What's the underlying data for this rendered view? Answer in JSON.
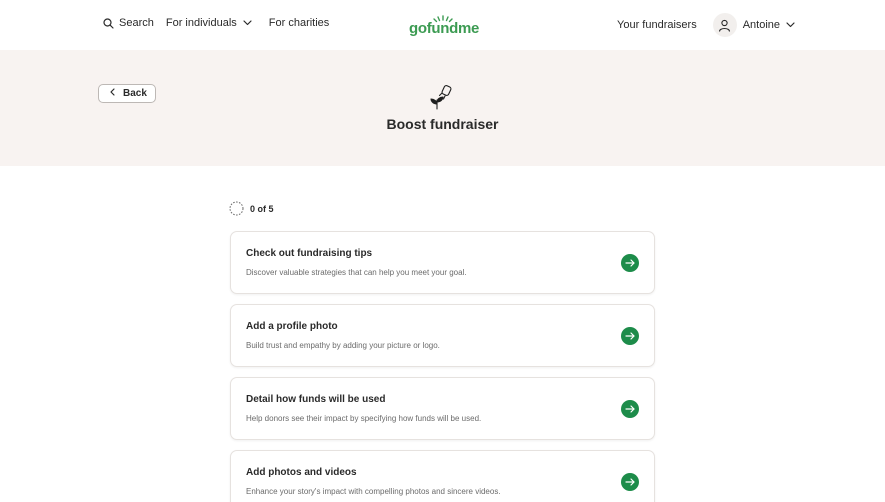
{
  "header": {
    "search_label": "Search",
    "individuals_label": "For individuals",
    "charities_label": "For charities",
    "logo_text": "gofundme",
    "fundraisers_label": "Your fundraisers",
    "user_name": "Antoine"
  },
  "hero": {
    "back_label": "Back",
    "title": "Boost fundraiser"
  },
  "progress": {
    "label": "0 of 5",
    "completed": 0,
    "total": 5
  },
  "tasks": [
    {
      "title": "Check out fundraising tips",
      "description": "Discover valuable strategies that can help you meet your goal."
    },
    {
      "title": "Add a profile photo",
      "description": "Build trust and empathy by adding your picture or logo."
    },
    {
      "title": "Detail how funds will be used",
      "description": "Help donors see their impact by specifying how funds will be used."
    },
    {
      "title": "Add photos and videos",
      "description": "Enhance your story's impact with compelling photos and sincere videos."
    }
  ],
  "colors": {
    "brand_green": "#3c9b52",
    "arrow_green": "#1d8c4a",
    "hero_background": "#f8f3f1"
  },
  "icons": [
    "search-icon",
    "chevron-down-icon",
    "user-icon",
    "chevron-left-icon",
    "plant-watering-icon",
    "progress-ring-icon",
    "arrow-right-icon"
  ]
}
